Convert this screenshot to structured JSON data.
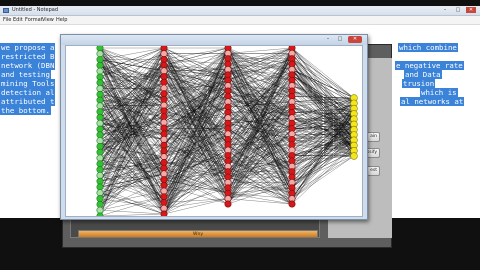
{
  "notepad": {
    "title": "Untitled - Notepad",
    "menu": [
      "File",
      "Edit",
      "Format",
      "View",
      "Help"
    ],
    "lines_left": [
      "we propose a",
      "restricted B",
      "network (DBN",
      "and testing",
      "mining Tools",
      "detection al",
      "attributed t",
      "the bottom."
    ],
    "lines_right": [
      "which combine",
      "e negative rate",
      "and Data",
      "trusion",
      "which is",
      "al networks at"
    ],
    "controls": [
      "–",
      "□",
      "✕"
    ]
  },
  "app": {
    "buttons": [
      "ain",
      "ssify",
      "est"
    ],
    "progress_label": "Wny",
    "progress_value": 1.0,
    "accent_color": "#d07a1c"
  },
  "network_window": {
    "controls": [
      "–",
      "□",
      "✕"
    ],
    "layers": [
      {
        "name": "input",
        "count": 30,
        "fill": "#33c133",
        "stroke": "#1f7a1f",
        "fill_alt": "#a8e0a8"
      },
      {
        "name": "hidden-1",
        "count": 30,
        "fill": "#d61818",
        "stroke": "#7d0c0c",
        "fill_alt": "#f2a9a9"
      },
      {
        "name": "hidden-2",
        "count": 30,
        "fill": "#d61818",
        "stroke": "#7d0c0c",
        "fill_alt": "#f2a9a9"
      },
      {
        "name": "hidden-3",
        "count": 30,
        "fill": "#d61818",
        "stroke": "#7d0c0c",
        "fill_alt": "#f2a9a9"
      },
      {
        "name": "output",
        "count": 12,
        "fill": "#f3e61c",
        "stroke": "#8a8000",
        "fill_alt": "#f3e61c"
      }
    ]
  }
}
